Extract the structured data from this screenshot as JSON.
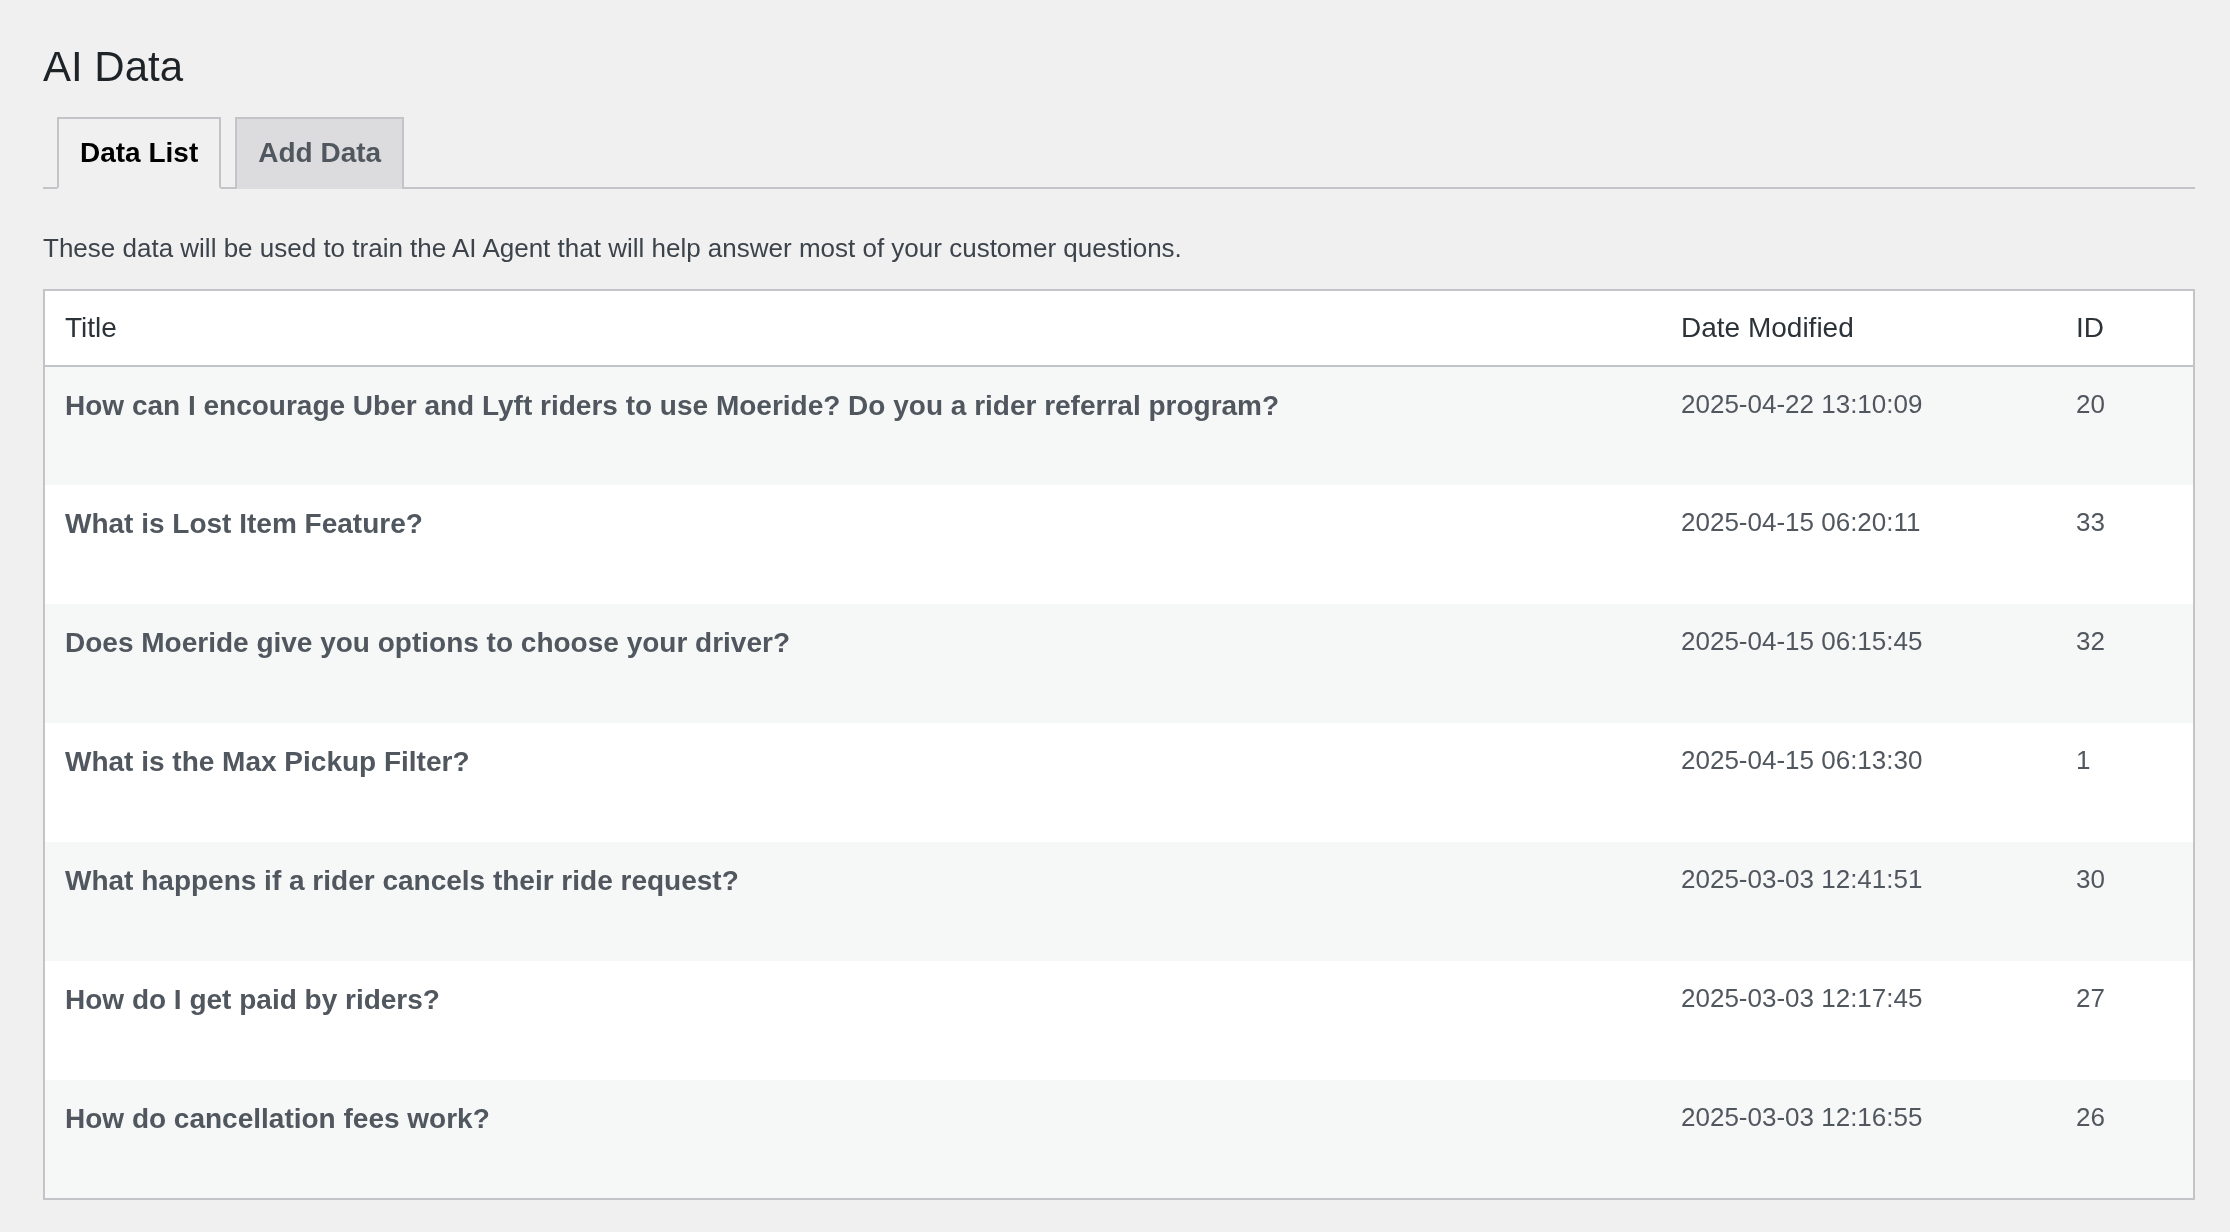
{
  "page_title": "AI Data",
  "tabs": [
    {
      "label": "Data List",
      "selected": true
    },
    {
      "label": "Add Data",
      "selected": false
    }
  ],
  "description": "These data will be used to train the AI Agent that will help answer most of your customer questions.",
  "table": {
    "columns": [
      "Title",
      "Date Modified",
      "ID"
    ],
    "rows": [
      {
        "title": "How can I encourage Uber and Lyft riders to use Moeride? Do you a rider referral program?",
        "date_modified": "2025-04-22 13:10:09",
        "id": "20"
      },
      {
        "title": "What is Lost Item Feature?",
        "date_modified": "2025-04-15 06:20:11",
        "id": "33"
      },
      {
        "title": "Does Moeride give you options to choose your driver?",
        "date_modified": "2025-04-15 06:15:45",
        "id": "32"
      },
      {
        "title": "What is the Max Pickup Filter?",
        "date_modified": "2025-04-15 06:13:30",
        "id": "1"
      },
      {
        "title": "What happens if a rider cancels their ride request?",
        "date_modified": "2025-03-03 12:41:51",
        "id": "30"
      },
      {
        "title": "How do I get paid by riders?",
        "date_modified": "2025-03-03 12:17:45",
        "id": "27"
      },
      {
        "title": "How do cancellation fees work?",
        "date_modified": "2025-03-03 12:16:55",
        "id": "26"
      }
    ]
  }
}
